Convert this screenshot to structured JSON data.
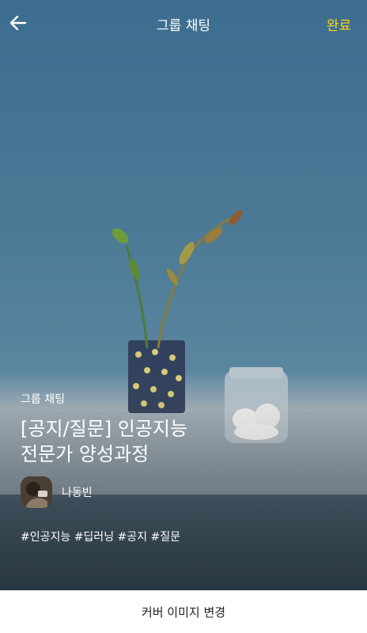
{
  "header": {
    "title": "그룹 채팅",
    "done_label": "완료",
    "done_color": "#ffd51a",
    "back_icon": "arrow-left-icon"
  },
  "room": {
    "category": "그룹 채팅",
    "title_line1": "[공지/질문] 인공지능",
    "title_line2": "전문가 양성과정",
    "host_name": "나동빈",
    "hashtags": "#인공지능 #딥러닝 #공지 #질문"
  },
  "footer": {
    "change_cover_label": "커버 이미지 변경"
  }
}
